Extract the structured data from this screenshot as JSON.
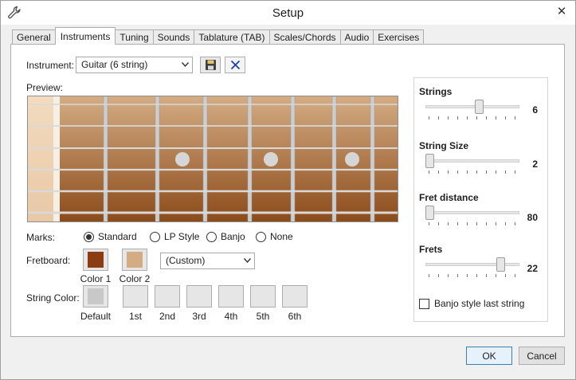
{
  "window": {
    "title": "Setup",
    "icon": "wrench-icon",
    "close_glyph": "✕"
  },
  "tabs": [
    {
      "label": "General",
      "active": false
    },
    {
      "label": "Instruments",
      "active": true
    },
    {
      "label": "Tuning",
      "active": false
    },
    {
      "label": "Sounds",
      "active": false
    },
    {
      "label": "Tablature (TAB)",
      "active": false
    },
    {
      "label": "Scales/Chords",
      "active": false
    },
    {
      "label": "Audio",
      "active": false
    },
    {
      "label": "Exercises",
      "active": false
    }
  ],
  "instrument": {
    "label": "Instrument:",
    "value": "Guitar (6 string)",
    "save_icon": "floppy-disk-icon",
    "delete_icon": "x-icon"
  },
  "preview": {
    "label": "Preview:"
  },
  "marks": {
    "label": "Marks:",
    "options": [
      {
        "label": "Standard",
        "selected": true
      },
      {
        "label": "LP Style",
        "selected": false
      },
      {
        "label": "Banjo",
        "selected": false
      },
      {
        "label": "None",
        "selected": false
      }
    ]
  },
  "fretboard": {
    "label": "Fretboard:",
    "color1_label": "Color 1",
    "color1": "#8b3c12",
    "color2_label": "Color 2",
    "color2": "#d4ac83",
    "preset_value": "(Custom)"
  },
  "string_color": {
    "label": "String Color:",
    "default_label": "Default",
    "default_color": "#c8c8c8",
    "strings": [
      "1st",
      "2nd",
      "3rd",
      "4th",
      "5th",
      "6th"
    ]
  },
  "settings": {
    "strings": {
      "label": "Strings",
      "value": "6",
      "level": 0.58
    },
    "string_size": {
      "label": "String Size",
      "value": "2",
      "level": 0.0
    },
    "fret_distance": {
      "label": "Fret distance",
      "value": "80",
      "level": 0.0
    },
    "frets": {
      "label": "Frets",
      "value": "22",
      "level": 0.83
    },
    "banjo_style": {
      "label": "Banjo style last string",
      "checked": false
    }
  },
  "buttons": {
    "ok": "OK",
    "cancel": "Cancel"
  },
  "colors": {
    "accent": "#3c7fb1",
    "fret": "#cfcfcf",
    "inlay": "#d6d6d6"
  }
}
